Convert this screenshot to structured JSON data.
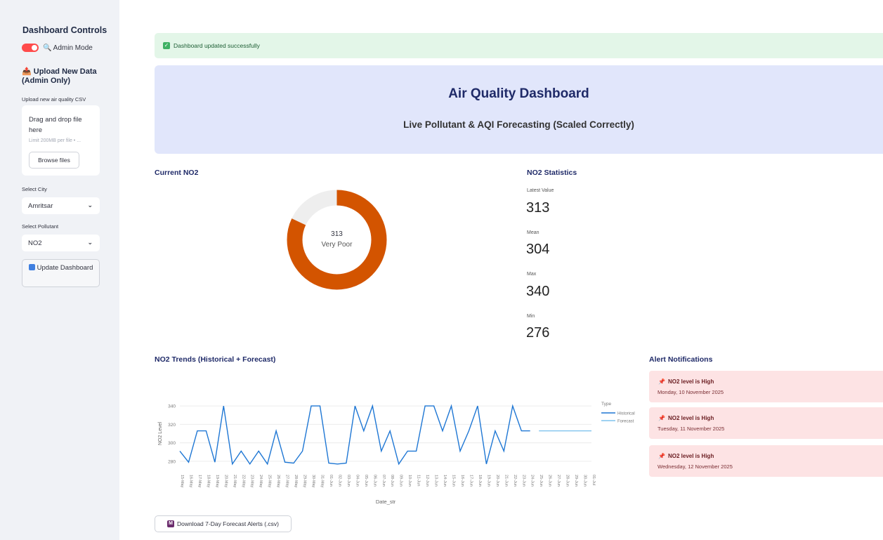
{
  "sidebar": {
    "title": "Dashboard Controls",
    "admin_toggle_label": "🔍 Admin Mode",
    "upload_header": "📤 Upload New Data (Admin Only)",
    "upload_label": "Upload new air quality CSV",
    "drop_text": "Drag and drop file here",
    "drop_limit": "Limit 200MB per file • ...",
    "browse_label": "Browse files",
    "city_label": "Select City",
    "city_value": "Amritsar",
    "pollutant_label": "Select Pollutant",
    "pollutant_value": "NO2",
    "update_label": "Update Dashboard"
  },
  "success_message": "Dashboard updated successfully",
  "header": {
    "title": "Air Quality Dashboard",
    "subtitle": "Live Pollutant & AQI Forecasting (Scaled Correctly)"
  },
  "current": {
    "title": "Current NO2",
    "value": "313",
    "category": "Very Poor",
    "fraction": 0.82,
    "color": "#d35400"
  },
  "stats": {
    "title": "NO2 Statistics",
    "latest_label": "Latest Value",
    "latest": "313",
    "mean_label": "Mean",
    "mean": "304",
    "max_label": "Max",
    "max": "340",
    "min_label": "Min",
    "min": "276"
  },
  "trend_title": "NO2 Trends (Historical + Forecast)",
  "chart_data": {
    "type": "line",
    "xlabel": "Date_str",
    "ylabel": "NO2 Level",
    "ylim": [
      270,
      350
    ],
    "yticks": [
      280,
      300,
      320,
      340
    ],
    "legend_title": "Type",
    "legend_position": "right",
    "x": [
      "15-May",
      "16-May",
      "17-May",
      "18-May",
      "19-May",
      "20-May",
      "21-May",
      "22-May",
      "23-May",
      "24-May",
      "25-May",
      "26-May",
      "27-May",
      "28-May",
      "29-May",
      "30-May",
      "31-May",
      "01-Jun",
      "02-Jun",
      "03-Jun",
      "04-Jun",
      "05-Jun",
      "06-Jun",
      "07-Jun",
      "08-Jun",
      "09-Jun",
      "10-Jun",
      "11-Jun",
      "12-Jun",
      "13-Jun",
      "14-Jun",
      "15-Jun",
      "16-Jun",
      "17-Jun",
      "18-Jun",
      "19-Jun",
      "20-Jun",
      "21-Jun",
      "22-Jun",
      "23-Jun",
      "24-Jun",
      "25-Jun",
      "26-Jun",
      "27-Jun",
      "28-Jun",
      "29-Jun",
      "30-Jun",
      "01-Jul"
    ],
    "series": [
      {
        "name": "Historical",
        "color": "#1f77d4",
        "start": 0,
        "values": [
          291,
          279,
          313,
          313,
          279,
          340,
          277,
          291,
          277,
          291,
          277,
          313,
          279,
          278,
          291,
          340,
          340,
          278,
          277,
          278,
          340,
          313,
          340,
          291,
          313,
          277,
          291,
          291,
          340,
          340,
          313,
          340,
          291,
          313,
          340,
          277,
          313,
          291,
          340,
          313,
          313
        ]
      },
      {
        "name": "Forecast",
        "color": "#7fc3ee",
        "start": 41,
        "values": [
          313,
          313,
          313,
          313,
          313,
          313,
          313
        ]
      }
    ]
  },
  "alerts": {
    "title": "Alert Notifications",
    "items": [
      {
        "title": "NO2 level is High",
        "date": "Monday, 10 November 2025"
      },
      {
        "title": "NO2 level is High",
        "date": "Tuesday, 11 November 2025"
      },
      {
        "title": "NO2 level is High",
        "date": "Wednesday, 12 November 2025"
      }
    ]
  },
  "download_label": "Download 7-Day Forecast Alerts (.csv)"
}
